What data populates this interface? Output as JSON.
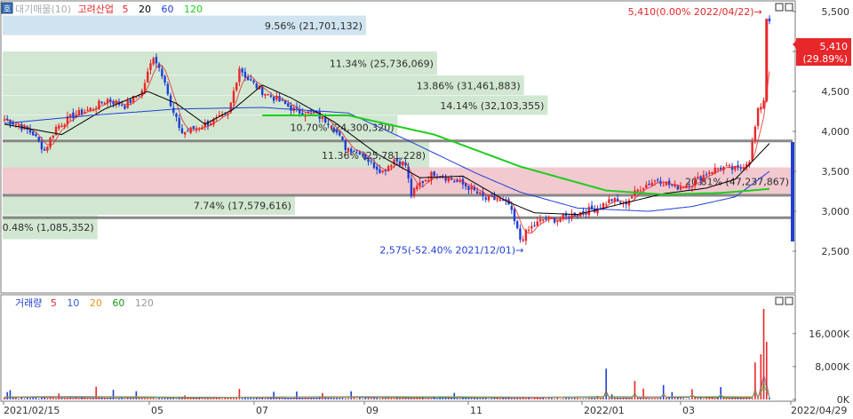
{
  "legend": {
    "price_title": "대기매물(10)",
    "stock_name": "고려산업",
    "ma_periods": [
      "5",
      "20",
      "60",
      "120"
    ],
    "volume_title": "거래량",
    "vol_ma_periods": [
      "5",
      "10",
      "20",
      "60",
      "120"
    ],
    "menu_icon_label": "호"
  },
  "colors": {
    "up": "#e8272a",
    "down": "#1f3fd6",
    "ma5": "#e8272a",
    "ma20": "#000000",
    "ma60": "#1f3fd6",
    "ma120": "#1fcc1f",
    "vma5": "#e8272a",
    "vma10": "#3060d0",
    "vma20": "#e89a20",
    "vma60": "#1a9a1a",
    "vma120": "#9a9a9a",
    "supply_band": "#cfe6cf",
    "top_band": "#cde2ef",
    "pink_band": "#f0c6cc",
    "grey_line": "#888888"
  },
  "chart_data": [
    {
      "type": "candlestick",
      "title": "고려산업 대기매물(10)",
      "yaxis_ticks": [
        "5,500",
        "5,000",
        "4,500",
        "4,000",
        "3,500",
        "3,000",
        "2,500"
      ],
      "ylim": [
        2000,
        5600
      ],
      "x_ticks": [
        "2021/02/15",
        "05",
        "07",
        "09",
        "11",
        "2022/01",
        "03",
        "2022/04/29"
      ],
      "price_range_bars": [
        {
          "label": "9.56% (21,701,132)",
          "low": 5200,
          "high": 5450,
          "color": "top"
        },
        {
          "label": "11.34% (25,736,069)",
          "low": 4700,
          "high": 5000,
          "color": "green"
        },
        {
          "label": "13.86% (31,461,883)",
          "low": 4450,
          "high": 4700,
          "color": "green"
        },
        {
          "label": "14.14% (32,103,355)",
          "low": 4200,
          "high": 4450,
          "color": "green"
        },
        {
          "label": "10.70% (24,300,320)",
          "low": 3900,
          "high": 4200,
          "color": "green"
        },
        {
          "label": "11.36% (25,781,228)",
          "low": 3500,
          "high": 3900,
          "color": "green"
        },
        {
          "label": "20.81% (47,237,867)",
          "low": 3200,
          "high": 3550,
          "color": "pink"
        },
        {
          "label": "7.74% (17,579,616)",
          "low": 2950,
          "high": 3200,
          "color": "green"
        },
        {
          "label": "0.48% (1,085,352)",
          "low": 2650,
          "high": 2950,
          "color": "green"
        }
      ],
      "horizontal_lines": [
        3880,
        3200,
        2920
      ],
      "annotations": {
        "high_label": "5,410(0.00% 2022/04/22)",
        "low_label": "2,575(-52.40% 2021/12/01)",
        "last_price": "5,410",
        "last_change": "(29.89%)"
      },
      "price_path": [
        [
          0,
          4150
        ],
        [
          5,
          4080
        ],
        [
          10,
          3970
        ],
        [
          14,
          3760
        ],
        [
          18,
          4050
        ],
        [
          24,
          4200
        ],
        [
          30,
          4280
        ],
        [
          36,
          4400
        ],
        [
          42,
          4320
        ],
        [
          48,
          4500
        ],
        [
          52,
          4950
        ],
        [
          56,
          4650
        ],
        [
          58,
          4300
        ],
        [
          62,
          3980
        ],
        [
          66,
          4030
        ],
        [
          72,
          4120
        ],
        [
          78,
          4200
        ],
        [
          82,
          4800
        ],
        [
          85,
          4650
        ],
        [
          90,
          4500
        ],
        [
          96,
          4380
        ],
        [
          102,
          4250
        ],
        [
          108,
          4220
        ],
        [
          114,
          4100
        ],
        [
          119,
          3800
        ],
        [
          124,
          3750
        ],
        [
          128,
          3600
        ],
        [
          132,
          3500
        ],
        [
          136,
          3650
        ],
        [
          140,
          3580
        ],
        [
          142,
          3200
        ],
        [
          145,
          3350
        ],
        [
          150,
          3480
        ],
        [
          156,
          3400
        ],
        [
          162,
          3300
        ],
        [
          168,
          3150
        ],
        [
          172,
          3150
        ],
        [
          176,
          3080
        ],
        [
          180,
          2650
        ],
        [
          184,
          2800
        ],
        [
          188,
          2900
        ],
        [
          194,
          2900
        ],
        [
          200,
          2980
        ],
        [
          206,
          3030
        ],
        [
          212,
          3150
        ],
        [
          216,
          3080
        ],
        [
          222,
          3300
        ],
        [
          228,
          3400
        ],
        [
          234,
          3300
        ],
        [
          240,
          3350
        ],
        [
          246,
          3500
        ],
        [
          250,
          3550
        ],
        [
          256,
          3520
        ],
        [
          260,
          3650
        ],
        [
          263,
          4250
        ],
        [
          265,
          4400
        ],
        [
          266,
          5410
        ],
        [
          267,
          5410
        ]
      ],
      "ma_path": {
        "ma20": [
          [
            0,
            4090
          ],
          [
            20,
            3960
          ],
          [
            35,
            4280
          ],
          [
            50,
            4500
          ],
          [
            60,
            4350
          ],
          [
            70,
            4090
          ],
          [
            80,
            4280
          ],
          [
            90,
            4580
          ],
          [
            100,
            4420
          ],
          [
            115,
            4120
          ],
          [
            130,
            3720
          ],
          [
            145,
            3420
          ],
          [
            160,
            3440
          ],
          [
            175,
            3130
          ],
          [
            185,
            2980
          ],
          [
            200,
            2960
          ],
          [
            215,
            3090
          ],
          [
            230,
            3220
          ],
          [
            245,
            3290
          ],
          [
            255,
            3400
          ],
          [
            267,
            3850
          ]
        ],
        "ma60": [
          [
            0,
            4100
          ],
          [
            30,
            4200
          ],
          [
            60,
            4280
          ],
          [
            90,
            4300
          ],
          [
            120,
            4230
          ],
          [
            140,
            3900
          ],
          [
            165,
            3470
          ],
          [
            180,
            3240
          ],
          [
            200,
            3040
          ],
          [
            225,
            3000
          ],
          [
            240,
            3060
          ],
          [
            255,
            3180
          ],
          [
            267,
            3500
          ]
        ],
        "ma120": [
          [
            90,
            4200
          ],
          [
            120,
            4200
          ],
          [
            150,
            3960
          ],
          [
            180,
            3560
          ],
          [
            210,
            3260
          ],
          [
            230,
            3210
          ],
          [
            250,
            3230
          ],
          [
            267,
            3280
          ]
        ]
      },
      "candles_count": 268
    },
    {
      "type": "bar",
      "title": "거래량",
      "yaxis_ticks": [
        "16,000K",
        "8,000K",
        "0K"
      ],
      "ylim": [
        0,
        22000
      ],
      "spikes": [
        [
          210,
          7500
        ],
        [
          220,
          4500
        ],
        [
          230,
          3500
        ],
        [
          240,
          2500
        ],
        [
          250,
          3000
        ],
        [
          262,
          9000
        ],
        [
          264,
          11000
        ],
        [
          265,
          22000
        ],
        [
          266,
          14000
        ]
      ]
    }
  ]
}
